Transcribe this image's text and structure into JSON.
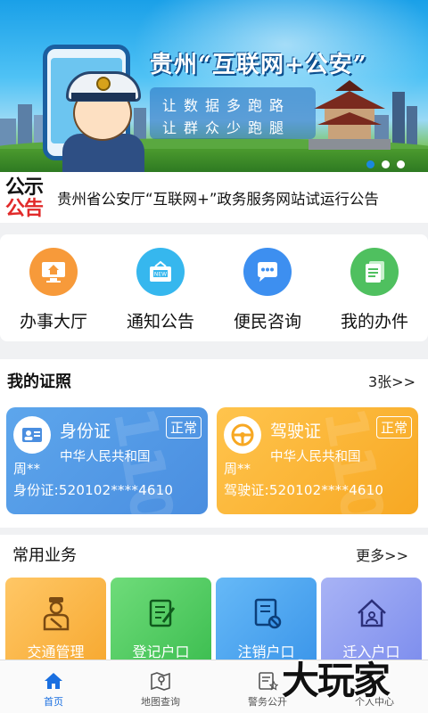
{
  "banner": {
    "title": "贵州“互联网+公安”",
    "slogan_line1": "让数据多跑路",
    "slogan_line2": "让群众少跑腿"
  },
  "notice": {
    "badge_top": "公示",
    "badge_bottom": "公告",
    "text": "贵州省公安厅“互联网+”政务服务网站试运行公告"
  },
  "services": [
    {
      "label": "办事大厅",
      "icon": "monitor-home-icon",
      "color": "#f79a3a"
    },
    {
      "label": "通知公告",
      "icon": "news-board-icon",
      "color": "#36b7ee"
    },
    {
      "label": "便民咨询",
      "icon": "chat-bubble-icon",
      "color": "#3d8ff0"
    },
    {
      "label": "我的办件",
      "icon": "documents-icon",
      "color": "#4fc05f"
    }
  ],
  "licenses": {
    "heading": "我的证照",
    "count_link": "3张>>",
    "cards": [
      {
        "title": "身份证",
        "status": "正常",
        "issuer": "中华人民共和国",
        "holder": "周**",
        "number": "身份证:520102****4610"
      },
      {
        "title": "驾驶证",
        "status": "正常",
        "issuer": "中华人民共和国",
        "holder": "周**",
        "number": "驾驶证:520102****4610"
      }
    ]
  },
  "business": {
    "heading": "常用业务",
    "more_link": "更多>>",
    "items": [
      {
        "label": "交通管理",
        "icon": "traffic-officer-icon"
      },
      {
        "label": "登记户口",
        "icon": "register-book-icon"
      },
      {
        "label": "注销户口",
        "icon": "cancel-document-icon"
      },
      {
        "label": "迁入户口",
        "icon": "move-in-house-icon"
      }
    ]
  },
  "tabbar": [
    {
      "label": "首页",
      "icon": "home-icon",
      "active": true
    },
    {
      "label": "地图查询",
      "icon": "map-icon",
      "active": false
    },
    {
      "label": "警务公开",
      "icon": "police-notice-icon",
      "active": false
    },
    {
      "label": "个人中心",
      "icon": "user-icon",
      "active": false
    }
  ],
  "watermark": "大玩家"
}
